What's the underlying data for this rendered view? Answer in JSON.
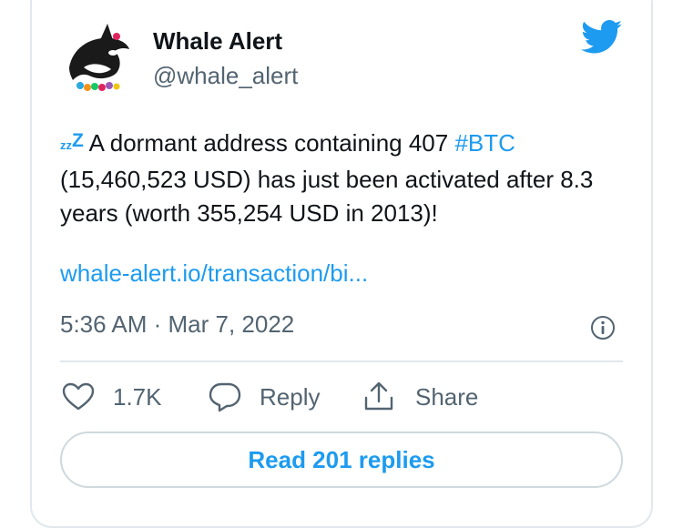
{
  "tweet": {
    "author_name": "Whale Alert",
    "author_handle": "@whale_alert",
    "text": {
      "zz_small": "zz",
      "zz_big": "Z",
      "part1": " A dormant address containing 407 ",
      "hashtag": "#BTC",
      "part2": " (15,460,523 USD) has just been activated after 8.3 years (worth 355,254 USD in 2013)!"
    },
    "link": "whale-alert.io/transaction/bi...",
    "timestamp": "5:36 AM · Mar 7, 2022"
  },
  "actions": {
    "like_count": "1.7K",
    "reply_label": "Reply",
    "share_label": "Share"
  },
  "read_replies_label": "Read 201 replies",
  "icons": {
    "avatar": "whale-avatar",
    "brand": "twitter-bird-icon",
    "info": "info-icon",
    "like": "heart-icon",
    "reply": "reply-bubble-icon",
    "share": "share-upload-icon"
  },
  "colors": {
    "accent": "#1d9bf0",
    "muted": "#536471",
    "border": "#e1e8ed"
  }
}
